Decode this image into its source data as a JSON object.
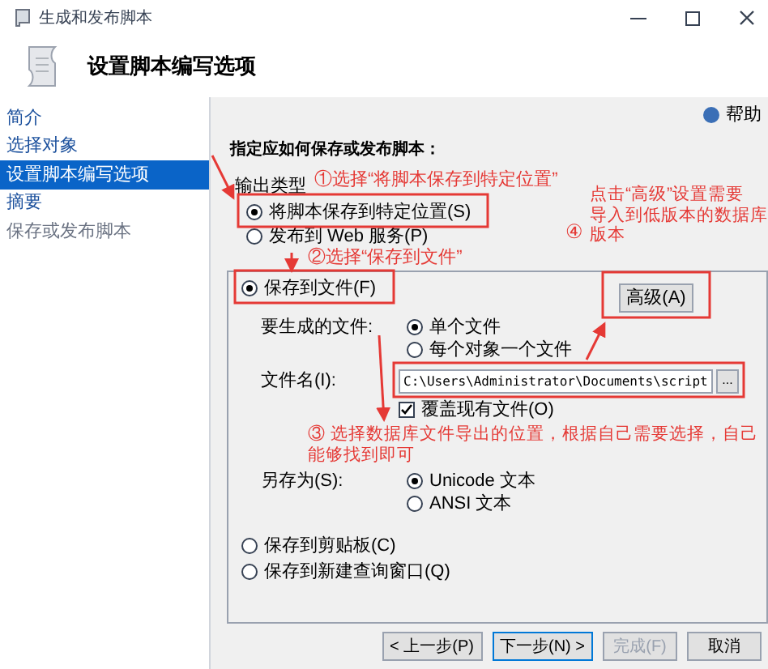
{
  "window": {
    "title": "生成和发布脚本"
  },
  "header": {
    "title": "设置脚本编写选项"
  },
  "sidebar": {
    "items": [
      {
        "label": "简介",
        "selected": false,
        "disabled": false
      },
      {
        "label": "选择对象",
        "selected": false,
        "disabled": false
      },
      {
        "label": "设置脚本编写选项",
        "selected": true,
        "disabled": false
      },
      {
        "label": "摘要",
        "selected": false,
        "disabled": false
      },
      {
        "label": "保存或发布脚本",
        "selected": false,
        "disabled": true
      }
    ]
  },
  "help": "帮助",
  "instruction": "指定应如何保存或发布脚本：",
  "output_type": {
    "label": "输出类型",
    "options": [
      {
        "label": "将脚本保存到特定位置(S)",
        "selected": true
      },
      {
        "label": "发布到 Web 服务(P)",
        "selected": false
      }
    ]
  },
  "file_group": {
    "save_to_file": {
      "label": "保存到文件(F)",
      "selected": true
    },
    "advanced_button": "高级(A)",
    "files_label": "要生成的文件:",
    "file_modes": [
      {
        "label": "单个文件",
        "selected": true
      },
      {
        "label": "每个对象一个文件",
        "selected": false
      }
    ],
    "file_name_label": "文件名(I):",
    "file_name": "C:\\Users\\Administrator\\Documents\\script",
    "browse_button": "...",
    "overwrite": {
      "label": "覆盖现有文件(O)",
      "checked": true
    },
    "save_as_label": "另存为(S):",
    "encodings": [
      {
        "label": "Unicode 文本",
        "selected": true
      },
      {
        "label": "ANSI 文本",
        "selected": false
      }
    ]
  },
  "other_destinations": [
    {
      "label": "保存到剪贴板(C)",
      "selected": false
    },
    {
      "label": "保存到新建查询窗口(Q)",
      "selected": false
    }
  ],
  "buttons": [
    {
      "label": "< 上一步(P)",
      "disabled": false,
      "default": false
    },
    {
      "label": "下一步(N) >",
      "disabled": false,
      "default": true
    },
    {
      "label": "完成(F)",
      "disabled": true,
      "default": false
    },
    {
      "label": "取消",
      "disabled": false,
      "default": false
    }
  ],
  "annotations": [
    {
      "lines": [
        "①选择“将脚本保存到特定位置”"
      ]
    },
    {
      "lines": [
        "②选择“保存到文件”"
      ]
    },
    {
      "lines": [
        "③ 选择数据库文件导出的位置，根据自己需要选择，自己",
        "能够找到即可"
      ]
    },
    {
      "lines": [
        "④"
      ]
    },
    {
      "lines": [
        "点击“高级”设置需要",
        "导入到低版本的数据库",
        "版本"
      ]
    }
  ]
}
